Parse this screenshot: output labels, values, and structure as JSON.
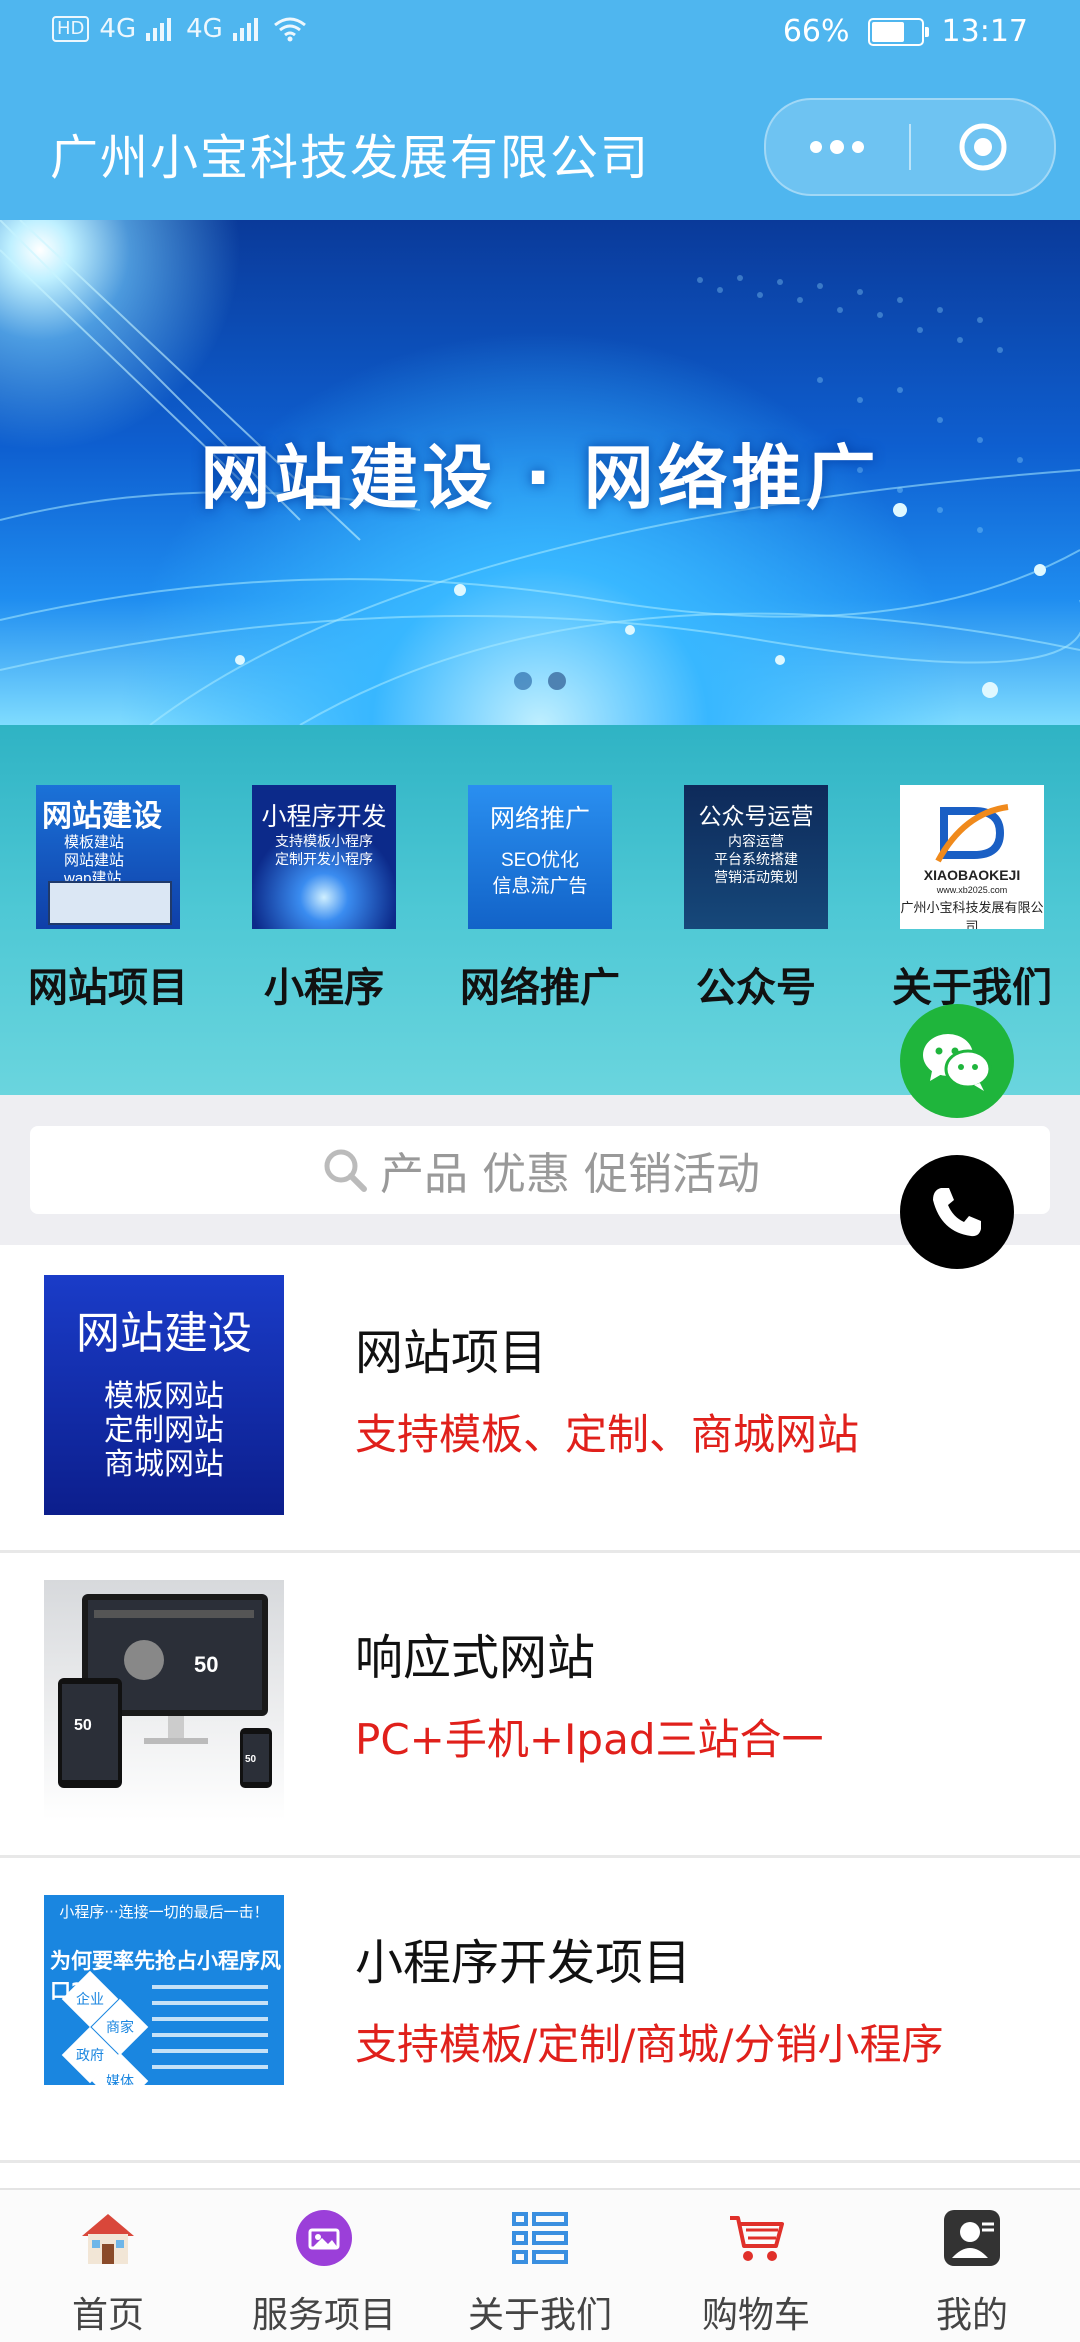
{
  "status_bar": {
    "network": "4G",
    "network2": "4G",
    "battery": "66%",
    "battery_level": 0.66,
    "time": "13:17"
  },
  "header": {
    "title": "广州小宝科技发展有限公司"
  },
  "banner": {
    "text": "网站建设 · 网络推广",
    "slides": 2,
    "active_slide": 2
  },
  "categories": [
    {
      "label": "网站项目",
      "thumb_title": "网站建设",
      "thumb_lines": [
        "模板建站",
        "网站建站",
        "wap建站"
      ]
    },
    {
      "label": "小程序",
      "thumb_title": "小程序开发",
      "thumb_lines": [
        "支持模板小程序",
        "定制开发小程序"
      ]
    },
    {
      "label": "网络推广",
      "thumb_title": "网络推广",
      "thumb_lines": [
        "SEO优化",
        "信息流广告"
      ]
    },
    {
      "label": "公众号",
      "thumb_title": "公众号运营",
      "thumb_lines": [
        "内容运营",
        "平台系统搭建",
        "营销活动策划"
      ]
    },
    {
      "label": "关于我们",
      "thumb_title": "XIAOBAOKEJI",
      "thumb_lines": [
        "www.xb2025.com",
        "广州小宝科技发展有限公司"
      ]
    }
  ],
  "search": {
    "placeholder": "产品 优惠 促销活动"
  },
  "products": [
    {
      "name": "网站项目",
      "desc": "支持模板、定制、商城网站",
      "thumb_title": "网站建设",
      "thumb_lines": [
        "模板网站",
        "定制网站",
        "商城网站"
      ]
    },
    {
      "name": "响应式网站",
      "desc": "PC+手机+Ipad三站合一",
      "thumb_badge": "50"
    },
    {
      "name": "小程序开发项目",
      "desc": "支持模板/定制/商城/分销小程序",
      "thumb_top": "小程序···连接一切的最后一击！",
      "thumb_title": "为何要率先抢占小程序风口?",
      "thumb_tags": [
        "企业",
        "商家",
        "政府",
        "媒体"
      ]
    }
  ],
  "tabbar": [
    {
      "label": "首页",
      "icon": "home-icon"
    },
    {
      "label": "服务项目",
      "icon": "service-icon"
    },
    {
      "label": "关于我们",
      "icon": "about-list-icon"
    },
    {
      "label": "购物车",
      "icon": "cart-icon"
    },
    {
      "label": "我的",
      "icon": "user-icon"
    }
  ],
  "colors": {
    "header": "#4fb6ef",
    "accent_red": "#e0201b",
    "wechat_green": "#1fb53c"
  }
}
